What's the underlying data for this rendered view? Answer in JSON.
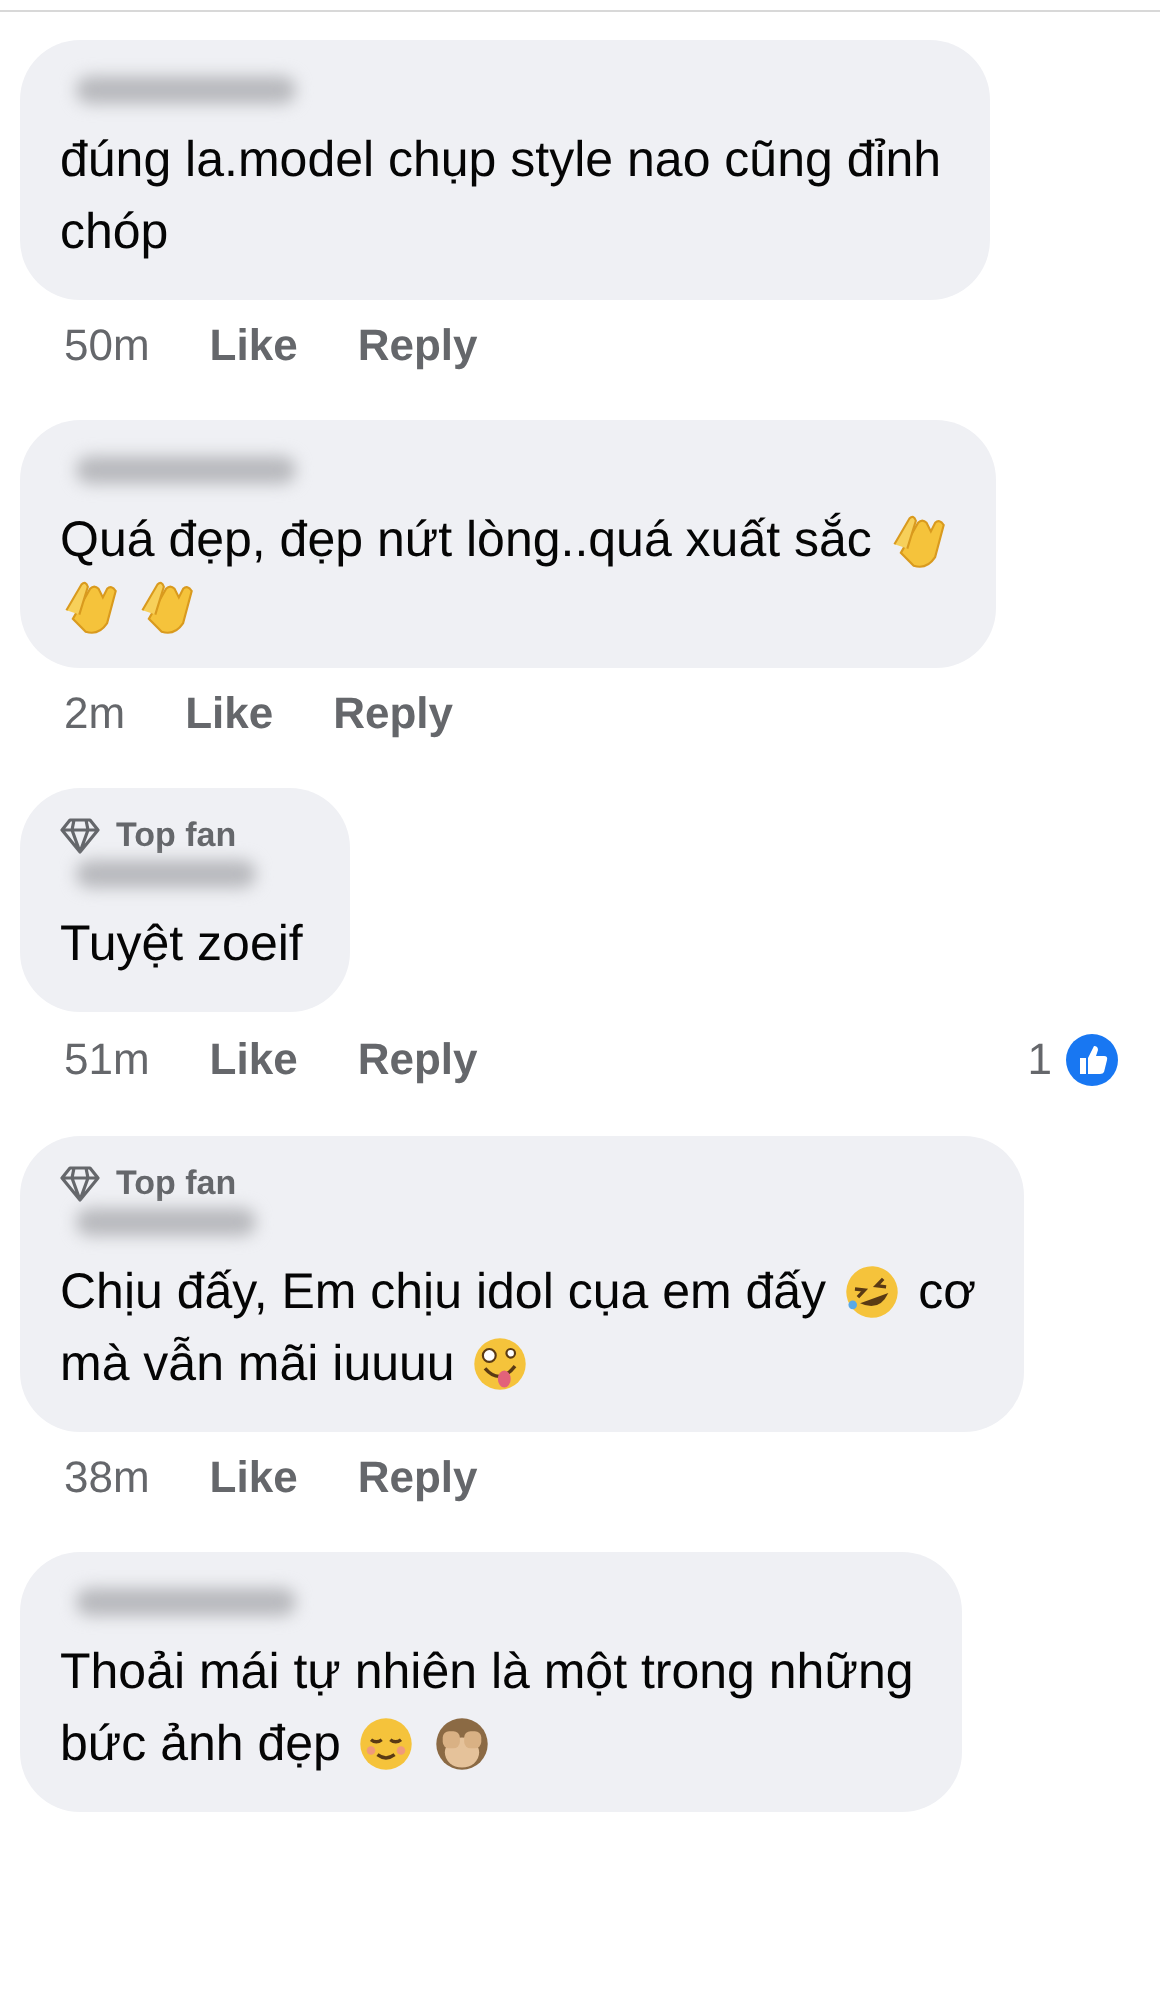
{
  "comments": [
    {
      "lines": [
        {
          "parts": [
            {
              "kind": "text",
              "text": "đúng la.model chụp style nao cũng đỉnh"
            }
          ]
        },
        {
          "parts": [
            {
              "kind": "text",
              "text": "chóp"
            }
          ]
        }
      ],
      "time": "50m",
      "like": "Like",
      "reply": "Reply"
    },
    {
      "lines": [
        {
          "parts": [
            {
              "kind": "text",
              "text": "Quá đẹp, đẹp nứt lòng..quá xuất sắc"
            },
            {
              "kind": "clap"
            }
          ]
        },
        {
          "parts": [
            {
              "kind": "clap"
            },
            {
              "kind": "clap"
            }
          ]
        }
      ],
      "time": "2m",
      "like": "Like",
      "reply": "Reply"
    },
    {
      "badge": "Top fan",
      "lines": [
        {
          "parts": [
            {
              "kind": "text",
              "text": "Tuyệt zoeif"
            }
          ]
        }
      ],
      "time": "51m",
      "like": "Like",
      "reply": "Reply",
      "reaction_count": "1"
    },
    {
      "badge": "Top fan",
      "lines": [
        {
          "parts": [
            {
              "kind": "text",
              "text": "Chịu đấy, Em chịu idol cụa em đấy"
            },
            {
              "kind": "rofl"
            },
            {
              "kind": "text",
              "text": "cơ"
            }
          ]
        },
        {
          "parts": [
            {
              "kind": "text",
              "text": "mà vẫn mãi iuuuu"
            },
            {
              "kind": "zany"
            }
          ]
        }
      ],
      "time": "38m",
      "like": "Like",
      "reply": "Reply"
    },
    {
      "lines": [
        {
          "parts": [
            {
              "kind": "text",
              "text": "Thoải mái tự nhiên là một trong những"
            }
          ]
        },
        {
          "parts": [
            {
              "kind": "text",
              "text": "bức ảnh đẹp"
            },
            {
              "kind": "relieved"
            },
            {
              "kind": "monkey"
            }
          ]
        }
      ]
    }
  ]
}
